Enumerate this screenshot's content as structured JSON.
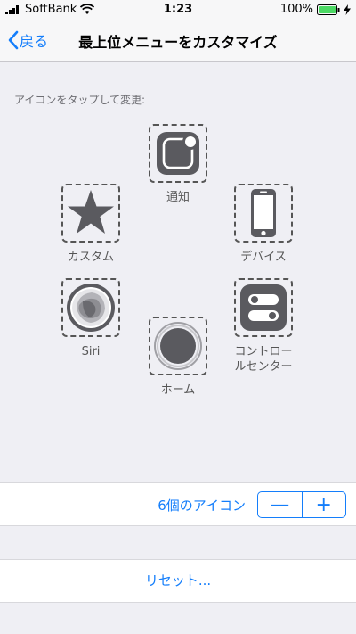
{
  "status_bar": {
    "carrier": "SoftBank",
    "time": "1:23",
    "battery": "100%"
  },
  "nav": {
    "back_label": "戻る",
    "title": "最上位メニューをカスタマイズ"
  },
  "hint": "アイコンをタップして変更:",
  "menu_icons": {
    "notification": "通知",
    "custom": "カスタム",
    "device": "デバイス",
    "siri": "Siri",
    "control_center_line1": "コントロー",
    "control_center_line2": "ルセンター",
    "home": "ホーム"
  },
  "counter": {
    "label": "6個のアイコン",
    "minus": "—",
    "plus": "+"
  },
  "reset_label": "リセット...",
  "colors": {
    "accent": "#147efb",
    "icon_fill": "#5a5a5f",
    "battery_green": "#4cd964"
  }
}
